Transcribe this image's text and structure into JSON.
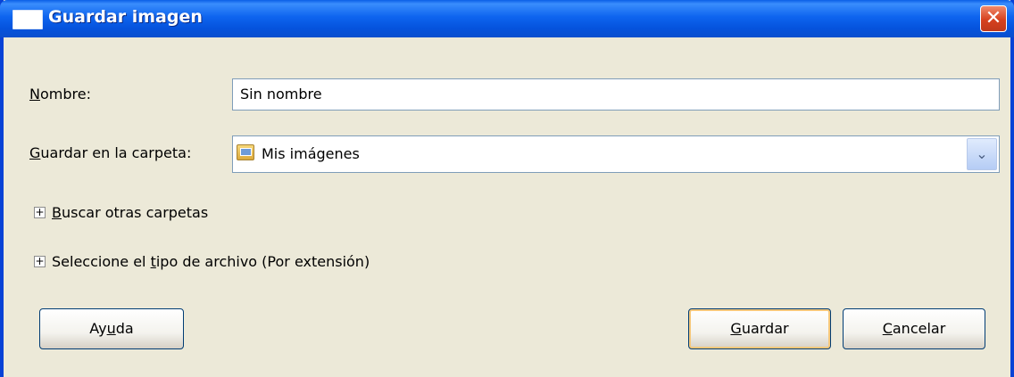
{
  "window": {
    "title": "Guardar imagen",
    "close_glyph": "✕"
  },
  "form": {
    "name_label_prefix": "N",
    "name_label_rest": "ombre:",
    "name_value": "Sin nombre",
    "folder_label_prefix": "G",
    "folder_label_rest": "uardar en la carpeta:",
    "folder_value": "Mis imágenes",
    "folder_icon": "folder-icon",
    "dropdown_glyph": "⌄"
  },
  "expanders": {
    "browse_prefix": "",
    "browse_mnemonic": "B",
    "browse_rest": "uscar otras carpetas",
    "filetype_prefix": "Seleccione el ",
    "filetype_mnemonic": "t",
    "filetype_rest": "ipo de archivo (Por extensión)",
    "expander_glyph": "+"
  },
  "buttons": {
    "help_prefix": "Ay",
    "help_mnemonic": "u",
    "help_rest": "da",
    "save_mnemonic": "G",
    "save_rest": "uardar",
    "cancel_mnemonic": "C",
    "cancel_rest": "ancelar"
  },
  "colors": {
    "titlebar": "#0a5fe6",
    "dialog_bg": "#ece9d8",
    "close": "#d6411f"
  }
}
